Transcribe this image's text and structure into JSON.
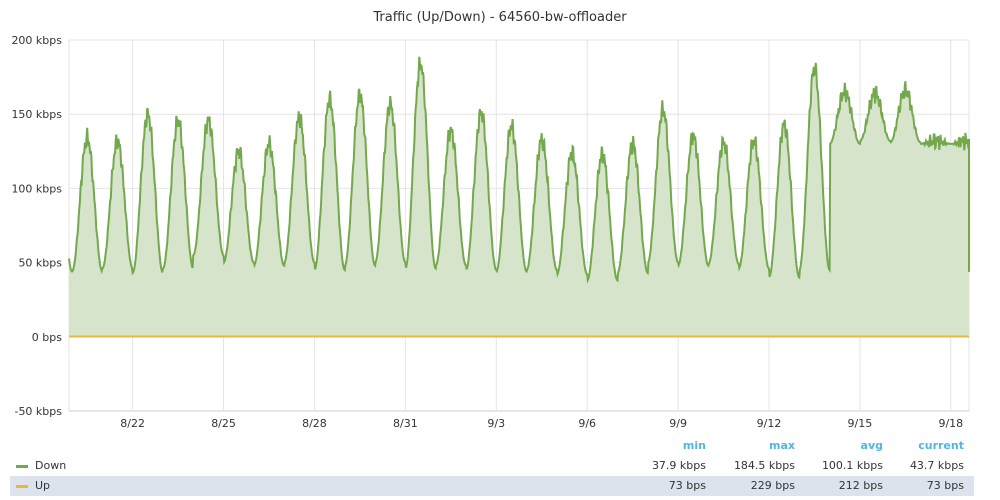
{
  "chart_data": {
    "type": "area",
    "title": "Traffic (Up/Down) - 64560-bw-offloader",
    "y_ticks": [
      "200 kbps",
      "150 kbps",
      "100 kbps",
      "50 kbps",
      "0 bps",
      "-50 kbps"
    ],
    "y_tick_values": [
      200,
      150,
      100,
      50,
      0,
      -50
    ],
    "ylim": [
      -50,
      200
    ],
    "yunit": "kbps",
    "x_ticks": [
      "8/22",
      "8/25",
      "8/28",
      "8/31",
      "9/3",
      "9/6",
      "9/9",
      "9/12",
      "9/15",
      "9/18"
    ],
    "x_tick_days": [
      2,
      5,
      8,
      11,
      14,
      17,
      20,
      23,
      26,
      29
    ],
    "xlim": [
      -0.1,
      29.6
    ],
    "grid": true,
    "legend_placement": "bottom",
    "colors": {
      "down_line": "#74a84c",
      "down_fill": "#d5e4cb",
      "up_line": "#eab839",
      "grid": "#e4e4e4",
      "legend_header": "#53b6e0",
      "legend_alt_row": "#dde3ec"
    },
    "series": [
      {
        "name": "Down",
        "daily_peaks": [
          134,
          132,
          150,
          146,
          146,
          125,
          130,
          148,
          160,
          163,
          157,
          184,
          139,
          151,
          142,
          133,
          124,
          123,
          130,
          153,
          135,
          131,
          132,
          143,
          181,
          165,
          164,
          166,
          132
        ],
        "daily_troughs": [
          44,
          46,
          43,
          46,
          55,
          50,
          48,
          50,
          45,
          48,
          50,
          46,
          48,
          45,
          44,
          45,
          42,
          38,
          43,
          50,
          48,
          49,
          46,
          40,
          45,
          130,
          132,
          131,
          130
        ],
        "current": 43.7
      },
      {
        "name": "Up",
        "values_kbps": [
          0.073,
          0.212,
          0.229
        ],
        "current": 0.073
      }
    ],
    "legend_table": {
      "headers": [
        "min",
        "max",
        "avg",
        "current"
      ],
      "rows": [
        {
          "name": "Down",
          "min": "37.9 kbps",
          "max": "184.5 kbps",
          "avg": "100.1 kbps",
          "current": "43.7 kbps",
          "color": "#74a84c"
        },
        {
          "name": "Up",
          "min": "73 bps",
          "max": "229 bps",
          "avg": "212 bps",
          "current": "73 bps",
          "color": "#eab839"
        }
      ]
    }
  }
}
